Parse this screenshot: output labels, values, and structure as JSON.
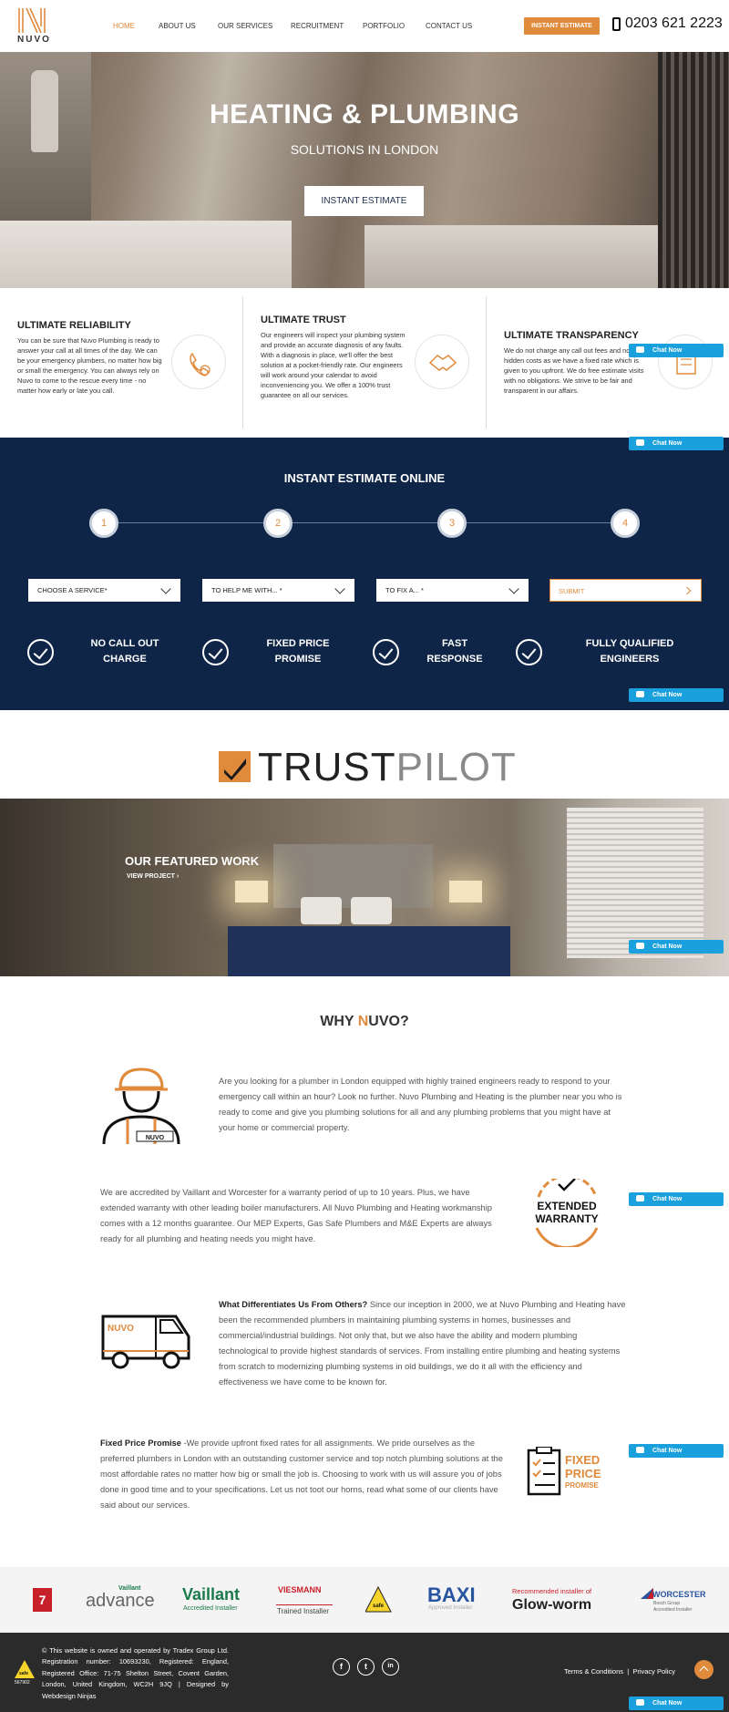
{
  "brand": {
    "name": "NUVO",
    "accent": "#e08a3c",
    "navy": "#0f2547",
    "chat_blue": "#1aa0dc"
  },
  "nav": {
    "items": [
      {
        "label": "HOME",
        "active": true
      },
      {
        "label": "ABOUT US"
      },
      {
        "label": "OUR SERVICES"
      },
      {
        "label": "RECRUITMENT"
      },
      {
        "label": "PORTFOLIO"
      },
      {
        "label": "CONTACT US"
      }
    ],
    "estimate_button": "INSTANT ESTIMATE",
    "phone": "0203 621 2223"
  },
  "hero": {
    "title": "HEATING & PLUMBING",
    "subtitle": "SOLUTIONS IN LONDON",
    "button": "INSTANT ESTIMATE"
  },
  "features": [
    {
      "title": "ULTIMATE RELIABILITY",
      "icon": "phone-24-icon",
      "body": "You can be sure that Nuvo Plumbing is ready to answer your call at all times of the day. We can be your emergency plumbers, no matter how big or small the emergency. You can always rely on Nuvo to come to the rescue every time - no matter how early or late you call."
    },
    {
      "title": "ULTIMATE TRUST",
      "icon": "handshake-icon",
      "body": "Our engineers will inspect your plumbing system and provide an accurate diagnosis of any faults. With a diagnosis in place, we'll offer the best solution at a pocket-friendly rate. Our engineers will work around your calendar to avoid inconveniencing you. We offer a 100% trust guarantee on all our services."
    },
    {
      "title": "ULTIMATE TRANSPARENCY",
      "icon": "checklist-icon",
      "body": "We do not charge any call out fees and no hidden costs as we have a fixed rate which is given to you upfront. We do free estimate visits with no obligations. We strive to be fair and transparent in our affairs."
    }
  ],
  "chat": {
    "label": "Chat Now"
  },
  "estimate": {
    "title": "INSTANT ESTIMATE ONLINE",
    "steps": [
      "1",
      "2",
      "3",
      "4"
    ],
    "selects": [
      "CHOOSE A SERVICE*",
      "TO HELP ME WITH... *",
      "TO FIX A... *"
    ],
    "submit": "SUBMIT",
    "benefits": [
      {
        "line1": "NO CALL OUT",
        "line2": "CHARGE"
      },
      {
        "line1": "FIXED PRICE",
        "line2": "PROMISE"
      },
      {
        "line1": "FAST",
        "line2": "RESPONSE"
      },
      {
        "line1": "FULLY QUALIFIED",
        "line2": "ENGINEERS"
      }
    ]
  },
  "trustpilot": {
    "part1": "TRUST",
    "part2": "PILOT"
  },
  "featured": {
    "title": "OUR FEATURED WORK",
    "link": "VIEW PROJECT"
  },
  "why": {
    "title_pre": "WHY ",
    "title_n": "N",
    "title_post": "UVO?",
    "p1": "Are you looking for a plumber in London equipped with highly trained engineers ready to respond to your emergency call within an hour? Look no further. Nuvo Plumbing and Heating is the plumber near you who is ready to come and give you plumbing solutions for all and any plumbing problems that you might have at your home or commercial property.",
    "engineer_badge": "NUVO",
    "p2": "We are accredited by Vaillant and Worcester for a warranty period of up to 10 years. Plus, we have extended warranty with other leading boiler manufacturers. All Nuvo Plumbing and Heating workmanship comes with a 12 months guarantee. Our MEP Experts, Gas Safe Plumbers and M&E Experts are always ready for all plumbing and heating needs you might have.",
    "warranty_line1": "EXTENDED",
    "warranty_line2": "WARRANTY",
    "p3_bold": "What Differentiates Us From Others?",
    "p3": " Since our inception in 2000, we at Nuvo Plumbing and Heating have been the recommended plumbers in maintaining plumbing systems in homes, businesses and commercial/industrial buildings. Not only that, but we also have the ability and modern plumbing technological to provide highest standards of services. From installing entire plumbing and heating systems from scratch to modernizing plumbing systems in old buildings, we do it all with the efficiency and effectiveness we have come to be known for.",
    "van_label": "NUVO",
    "p4_bold": "Fixed Price Promise",
    "p4": " -We provide upfront fixed rates for all assignments. We pride ourselves as the preferred plumbers in London with an outstanding customer service and top notch plumbing solutions at the most affordable rates no matter how big or small the job is. Choosing to work with us will assure you of jobs done in good time and to your specifications. Let us not toot our horns, read what some of our clients have said about our services.",
    "fpp_line1": "FIXED",
    "fpp_line2": "PRICE",
    "fpp_line3": "PROMISE"
  },
  "partners": {
    "seven_year": "7",
    "vaillant_small": "Vaillant",
    "advance": "advance",
    "vaillant": "Vaillant",
    "accredited_installer": "Accredited Installer",
    "viessmann": "VIESMANN",
    "trained_installer": "Trained Installer",
    "gas_safe": "safe",
    "baxi": "BAXI",
    "approved_installer": "Approved Installer",
    "recommended": "Recommended installer of",
    "glowworm": "Glow-worm",
    "worcester": "WORCESTER",
    "worcester_sub": "Bosch Group",
    "worcester_acc": "Accredited Installer"
  },
  "footer": {
    "gas_safe": "safe",
    "gas_safe_number": "567902",
    "text": "© This website is owned and operated by Tradex Group Ltd. Registration number: 10693230, Registered: England, Registered Office: 71-75 Shelton Street, Covent Garden, London, United Kingdom, WC2H 9JQ  |  Designed by Webdesign Ninjas",
    "social": [
      "f",
      "t",
      "in"
    ],
    "terms": "Terms & Conditions",
    "separator": "|",
    "privacy": "Privacy Policy"
  }
}
